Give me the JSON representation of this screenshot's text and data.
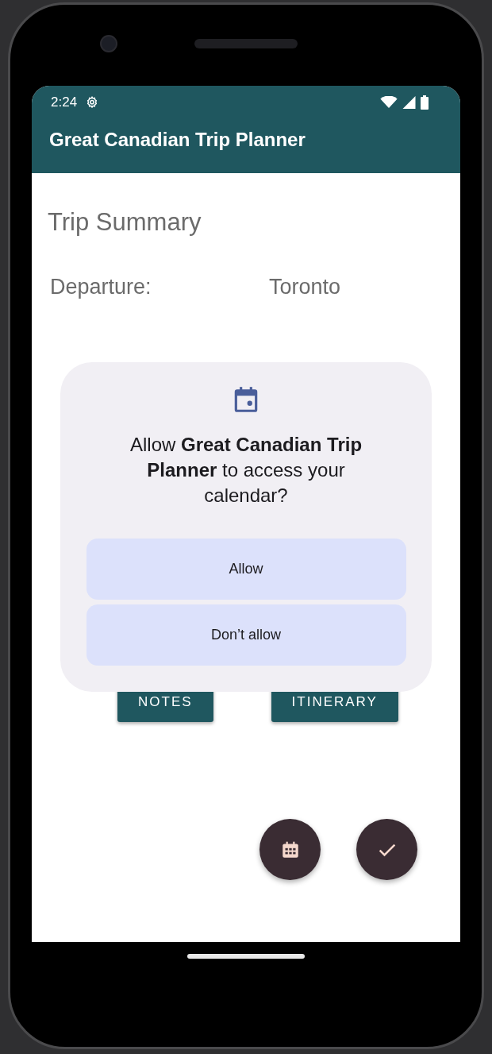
{
  "status_bar": {
    "time": "2:24"
  },
  "app_bar": {
    "title": "Great Canadian Trip Planner"
  },
  "summary": {
    "heading": "Trip Summary",
    "rows": [
      {
        "label": "Departure:",
        "value": "Toronto"
      }
    ]
  },
  "buttons": [
    {
      "label": "NOTES"
    },
    {
      "label": "ITINERARY"
    }
  ],
  "dialog": {
    "message": "Allow **Great Canadian Trip Planner** to access your calendar?",
    "actions": [
      {
        "label": "Allow"
      },
      {
        "label": "Don’t allow"
      }
    ]
  },
  "fabs": [
    {
      "kind": "calendar"
    },
    {
      "kind": "check"
    }
  ]
}
